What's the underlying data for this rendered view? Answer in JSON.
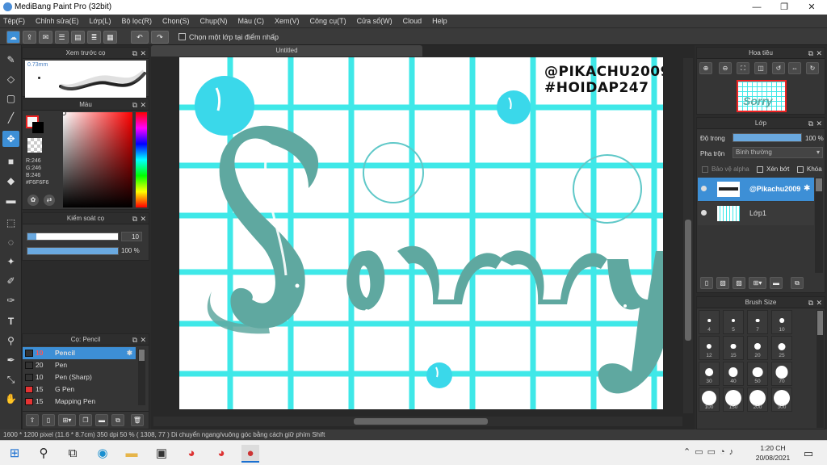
{
  "window": {
    "title": "MediBang Paint Pro (32bit)",
    "min": "—",
    "max": "❐",
    "close": "✕"
  },
  "menu": [
    "Tệp(F)",
    "Chỉnh sửa(E)",
    "Lớp(L)",
    "Bộ lọc(R)",
    "Chọn(S)",
    "Chụp(N)",
    "Màu (C)",
    "Xem(V)",
    "Công cụ(T)",
    "Cửa sổ(W)",
    "Cloud",
    "Help"
  ],
  "toolbar": {
    "snap_label": "Chọn một lớp tại điểm nhấp"
  },
  "brush_preview": {
    "title": "Xem trước cọ",
    "size_label": "0.73mm"
  },
  "color_panel": {
    "title": "Màu",
    "r": "R:246",
    "g": "G:246",
    "b": "B:246",
    "hex": "#F6F6F6",
    "primary_color": "#f6f6f6",
    "secondary_color": "#000000"
  },
  "brush_control": {
    "title": "Kiểm soát cọ",
    "size_value": "10",
    "opacity_value": "100 %",
    "size_fraction": 0.1,
    "opacity_fraction": 1.0
  },
  "brush_list": {
    "title": "Cọ: Pencil",
    "items": [
      {
        "size": "10",
        "name": "Pencil",
        "color": "#333333",
        "selected": true
      },
      {
        "size": "20",
        "name": "Pen",
        "color": "#333333"
      },
      {
        "size": "10",
        "name": "Pen (Sharp)",
        "color": "#333333"
      },
      {
        "size": "15",
        "name": "G Pen",
        "color": "#e53333"
      },
      {
        "size": "15",
        "name": "Mapping Pen",
        "color": "#e53333"
      }
    ]
  },
  "canvas": {
    "tab_label": "Untitled",
    "watermark_line1": "@PIKACHU2009",
    "watermark_line2": "#HOIDAP247",
    "main_text": "Sorry",
    "grid_color": "#3fe8e8",
    "ink_color": "#5fa8a0",
    "bubble_color": "#3ad8ea"
  },
  "navigator": {
    "title": "Hoa tiêu"
  },
  "layer_panel": {
    "title": "Lớp",
    "opacity_label": "Độ trong",
    "opacity_value": "100 %",
    "blend_label": "Pha trộn",
    "blend_value": "Bình thường",
    "protect_alpha": "Bảo vệ alpha",
    "clipping": "Xén bớt",
    "lock": "Khóa",
    "layers": [
      {
        "name": "@Pikachu2009",
        "selected": true
      },
      {
        "name": "Lớp1",
        "selected": false
      }
    ]
  },
  "brush_size_panel": {
    "title": "Brush Size",
    "sizes": [
      "4",
      "5",
      "7",
      "10",
      "12",
      "15",
      "20",
      "25",
      "30",
      "40",
      "50",
      "70",
      "100",
      "150",
      "200",
      "300"
    ]
  },
  "status": {
    "text": "1600 * 1200 pixel  (11.6 * 8.7cm)  350 dpi  50 %  ( 1308, 77 )  Di chuyển ngang/vuông góc bằng cách giữ phím Shift"
  },
  "taskbar": {
    "time": "1:20 CH",
    "date": "20/08/2021"
  }
}
